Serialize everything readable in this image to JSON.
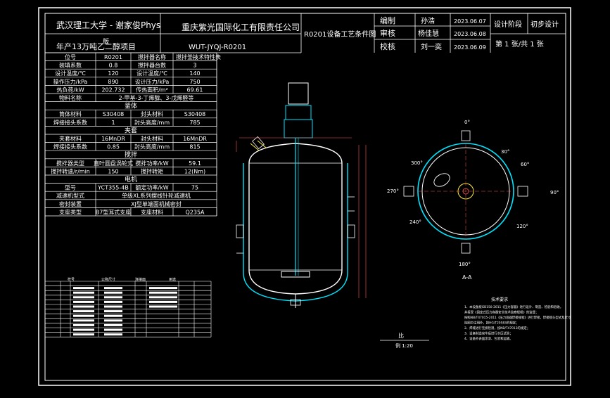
{
  "title_block": {
    "university": "武汉理工大学 - 谢家俊Phys",
    "sheet_small": "版",
    "company": "重庆紫光国际化工有限责任公司",
    "project": "年产13万吨乙二醇项目",
    "drawing_no": "WUT-JYQJ-R0201",
    "drawing_name": "R0201设备工艺条件图",
    "roles": [
      {
        "role": "编制",
        "name": "孙浩",
        "date": "2023.06.07"
      },
      {
        "role": "审核",
        "name": "杨佳慧",
        "date": "2023.06.08"
      },
      {
        "role": "校核",
        "name": "刘一奕",
        "date": "2023.06.09"
      }
    ],
    "stage_label": "设计阶段",
    "stage_value": "初步设计",
    "sheet": "第 1 张/共 1 张",
    "scale_label": "比",
    "scale_value": "例 1:20"
  },
  "spec_header": "搅拌釜技术特性表",
  "spec_rows": [
    [
      "位号",
      "R0201",
      "搅拌器名称",
      "—"
    ],
    [
      "装填系数",
      "0.8",
      "搅拌器台数",
      "3"
    ],
    [
      "设计温度/℃",
      "120",
      "设计温度/℃",
      "140"
    ],
    [
      "操作压力/kPa",
      "890",
      "设计压力/kPa",
      "750"
    ],
    [
      "热负荷/kW",
      "202.732",
      "传热面积/m²",
      "69.61"
    ],
    [
      "物料名称",
      "2-甲基-3-丁烯醇、3-戊烯醛等",
      "",
      ""
    ]
  ],
  "section_1": "釜体",
  "spec_rows_2": [
    [
      "筒体材料",
      "S30408",
      "封头材料",
      "S30408"
    ],
    [
      "焊接接头系数",
      "1",
      "封头高度/mm",
      "785"
    ]
  ],
  "section_2": "夹套",
  "spec_rows_3": [
    [
      "夹套材料",
      "16MnDR",
      "封头材料",
      "16MnDR"
    ],
    [
      "焊接接头系数",
      "0.85",
      "封头高度/mm",
      "815"
    ]
  ],
  "section_3": "搅拌",
  "spec_rows_4": [
    [
      "搅拌器类型",
      "直叶圆盘涡轮式",
      "搅拌功率/kW",
      "59.1"
    ],
    [
      "搅拌转速/r/min",
      "150",
      "搅拌转矩",
      "12(Nm)"
    ]
  ],
  "section_4": "电机",
  "spec_rows_5": [
    [
      "型号",
      "YCT355-4B",
      "额定功率/kW",
      "75"
    ],
    [
      "减速机型式",
      "单级XL系列摆线针轮减速机",
      "",
      ""
    ],
    [
      "密封装置",
      "XJ型单端面机械密封",
      "",
      ""
    ],
    [
      "支座类型",
      "B7型耳式支座",
      "支座材料",
      "Q235A"
    ]
  ],
  "nozzle_header": [
    "符号",
    "公称尺寸",
    "连接面",
    "用途"
  ],
  "nozzle_rows": 12,
  "plan": {
    "angles": [
      "0°",
      "30°",
      "60°",
      "90°",
      "120°",
      "180°",
      "240°",
      "270°",
      "300°"
    ],
    "section_label": "A-A"
  },
  "tech_notes_title": "技术要求",
  "tech_notes": [
    "1、本设备按GB150-2011《压力容器》进行设计、制造、检验和验收，",
    "并接受《固定式压力容器安全技术监察规程》的监督；",
    "按照NB/T47015-2011《压力容器焊接规程》进行焊接，焊接接头型式及尺寸",
    "除图中注明外，按HG/T20583的规定；",
    "2、焊缝进行无损检测，按NB/T47013的规定；",
    "3、设备制造完毕后进行水压试验；",
    "4、设备外表面涂漆、包装和运输。"
  ],
  "colors": {
    "bg": "#000000",
    "frame": "#ffffff",
    "vessel": "#00e5ff",
    "dim": "#ff5252",
    "accent": "#ffeb3b"
  }
}
